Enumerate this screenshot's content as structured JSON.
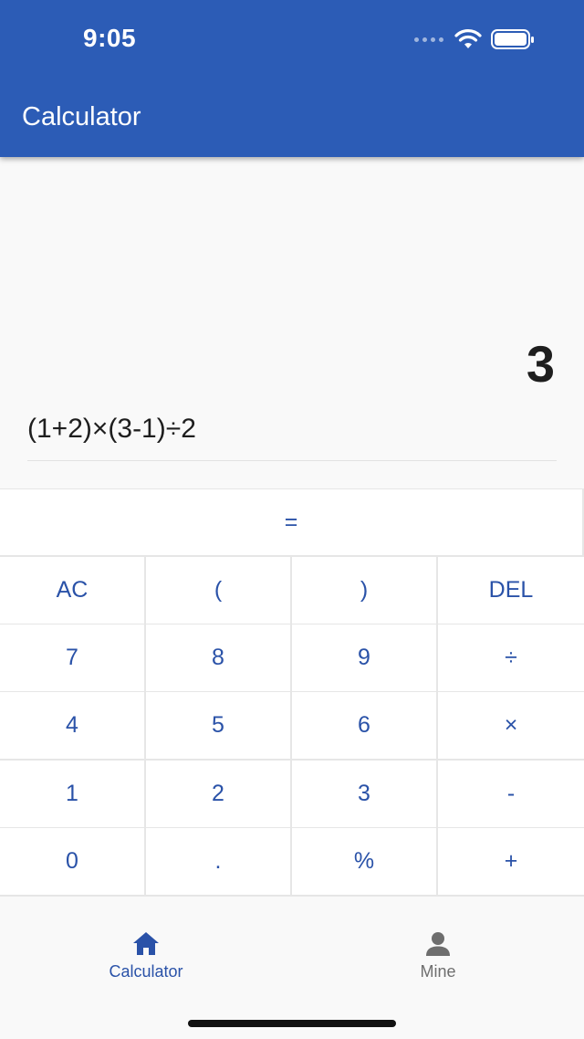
{
  "status_bar": {
    "time": "9:05"
  },
  "app_bar": {
    "title": "Calculator"
  },
  "display": {
    "result": "3",
    "expression": "(1+2)×(3-1)÷2"
  },
  "keypad": {
    "equals": "=",
    "rows": [
      [
        "AC",
        "(",
        ")",
        "DEL"
      ],
      [
        "7",
        "8",
        "9",
        "÷"
      ],
      [
        "4",
        "5",
        "6",
        "×"
      ],
      [
        "1",
        "2",
        "3",
        "-"
      ],
      [
        "0",
        ".",
        "%",
        "+"
      ]
    ]
  },
  "bottom_nav": {
    "items": [
      {
        "label": "Calculator",
        "icon": "home-icon",
        "active": true
      },
      {
        "label": "Mine",
        "icon": "person-icon",
        "active": false
      }
    ]
  },
  "colors": {
    "primary": "#2c5cb6",
    "key_text": "#2a52a8",
    "inactive": "#6e6e6e"
  }
}
